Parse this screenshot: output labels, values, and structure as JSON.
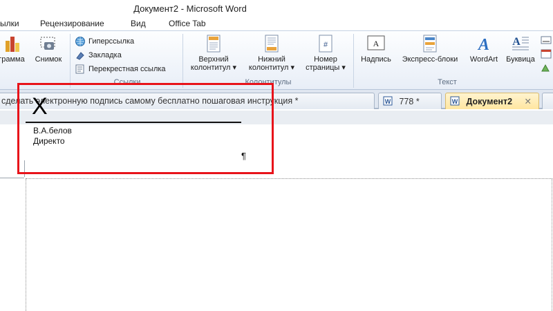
{
  "window": {
    "title": "Документ2  -  Microsoft Word"
  },
  "menu_tabs": [
    "ылки",
    "Рецензирование",
    "Вид",
    "Office Tab"
  ],
  "ribbon": {
    "illustrations": {
      "chart_label": "грамма",
      "screenshot_label": "Снимок"
    },
    "links": {
      "hyperlink_label": "Гиперссылка",
      "bookmark_label": "Закладка",
      "crossref_label": "Перекрестная ссылка",
      "group_label": "Ссылки"
    },
    "header_footer": {
      "header_label_1": "Верхний",
      "header_label_2": "колонтитул",
      "footer_label_1": "Нижний",
      "footer_label_2": "колонтитул",
      "page_number_label_1": "Номер",
      "page_number_label_2": "страницы",
      "group_label": "Колонтитулы"
    },
    "text": {
      "textbox_label": "Надпись",
      "quickparts_label": "Экспресс-блоки",
      "wordart_label": "WordArt",
      "dropcap_label": "Буквица",
      "group_label": "Текст"
    }
  },
  "doc_tabs": [
    {
      "label": "сделать электронную подпись самому бесплатно пошаговая инструкция *",
      "active": false
    },
    {
      "label": "778 *",
      "active": false
    },
    {
      "label": "Документ2",
      "active": true
    }
  ],
  "document": {
    "signature_mark": "X",
    "signer_name": "В.А.белов",
    "signer_title": "Директо",
    "paragraph_mark": "¶"
  },
  "colors": {
    "highlight": "#e8131a",
    "active_tab": "#ffe6a0",
    "ribbon_bg": "#e8eef7"
  }
}
